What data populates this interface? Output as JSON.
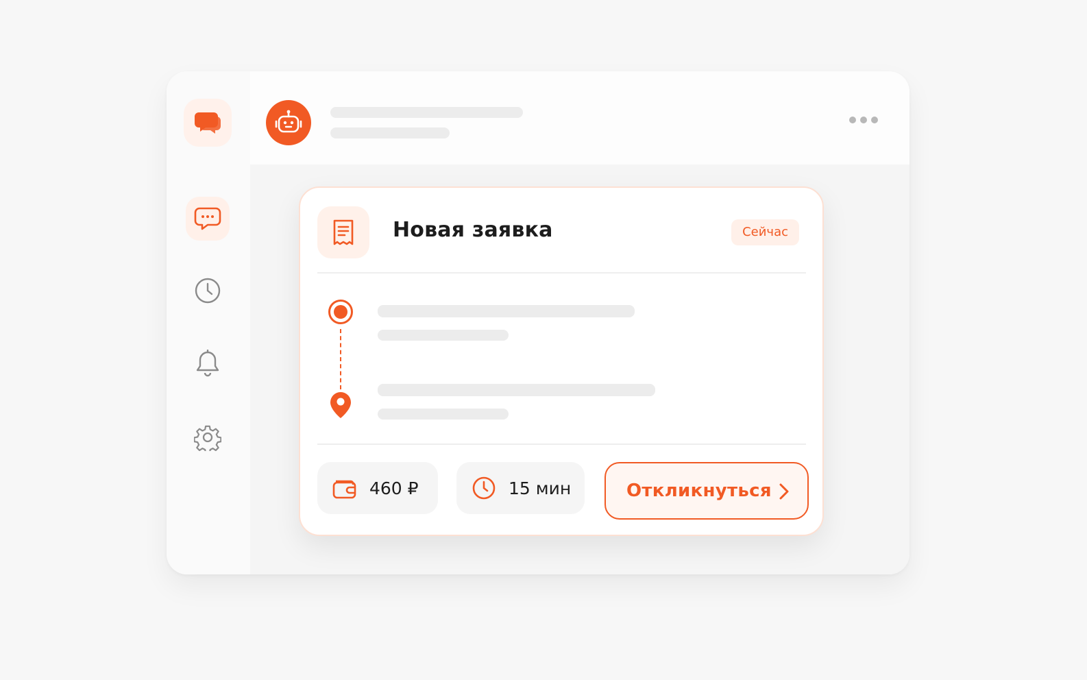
{
  "card": {
    "title": "Новая заявка",
    "time_badge": "Сейчас",
    "price": "460 ₽",
    "duration": "15 мин",
    "respond_label": "Откликнуться"
  },
  "colors": {
    "accent": "#f15a24",
    "accent_soft": "#fff0e9",
    "text": "#1d1d1d"
  },
  "icons": {
    "sidebar": [
      "chat-bubbles-icon",
      "chat-dots-icon",
      "clock-icon",
      "bell-icon",
      "gear-icon"
    ],
    "header": [
      "robot-icon",
      "more-dots-icon"
    ],
    "card": [
      "document-icon",
      "route-start-icon",
      "map-pin-icon",
      "wallet-icon",
      "clock-icon",
      "chevron-right-icon"
    ]
  }
}
